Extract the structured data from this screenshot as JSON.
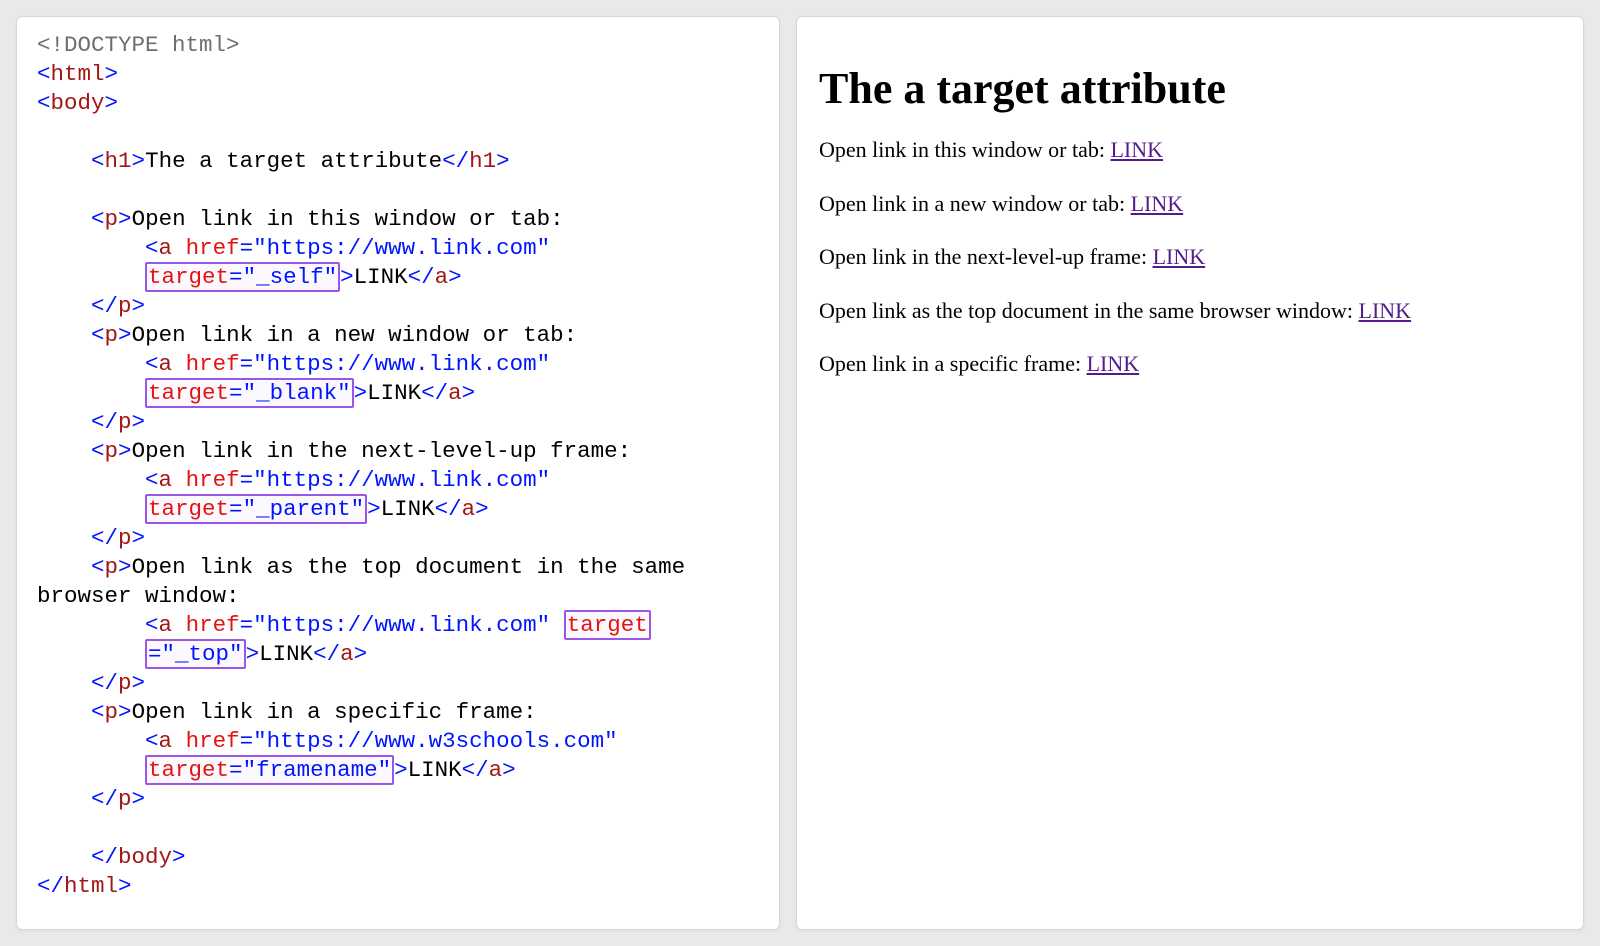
{
  "code": {
    "doctype": "<!DOCTYPE html>",
    "html_open": "html",
    "body_open": "body",
    "h1_open": "h1",
    "h1_text": "The a target attribute",
    "h1_close": "h1",
    "p": "p",
    "a": "a",
    "href_attr": "href",
    "target_attr": "target",
    "eq": "=",
    "link_text": "LINK",
    "paras": [
      {
        "text": "Open link in this window or tab:",
        "href": "\"https://www.link.com\"",
        "target": "\"_self\""
      },
      {
        "text": "Open link in a new window or tab:",
        "href": "\"https://www.link.com\"",
        "target": "\"_blank\""
      },
      {
        "text": "Open link in the next-level-up frame:",
        "href": "\"https://www.link.com\"",
        "target": "\"_parent\""
      },
      {
        "text": "Open link as the top document in the same browser window:",
        "href": "\"https://www.link.com\"",
        "target": "\"_top\""
      },
      {
        "text": "Open link in a specific frame:",
        "href": "\"https://www.w3schools.com\"",
        "target": "\"framename\""
      }
    ]
  },
  "preview": {
    "title": "The a target attribute",
    "items": [
      {
        "text": "Open link in this window or tab: ",
        "link": "LINK"
      },
      {
        "text": "Open link in a new window or tab: ",
        "link": "LINK"
      },
      {
        "text": "Open link in the next-level-up frame: ",
        "link": "LINK"
      },
      {
        "text": "Open link as the top document in the same browser window: ",
        "link": "LINK"
      },
      {
        "text": "Open link in a specific frame: ",
        "link": "LINK"
      }
    ]
  }
}
